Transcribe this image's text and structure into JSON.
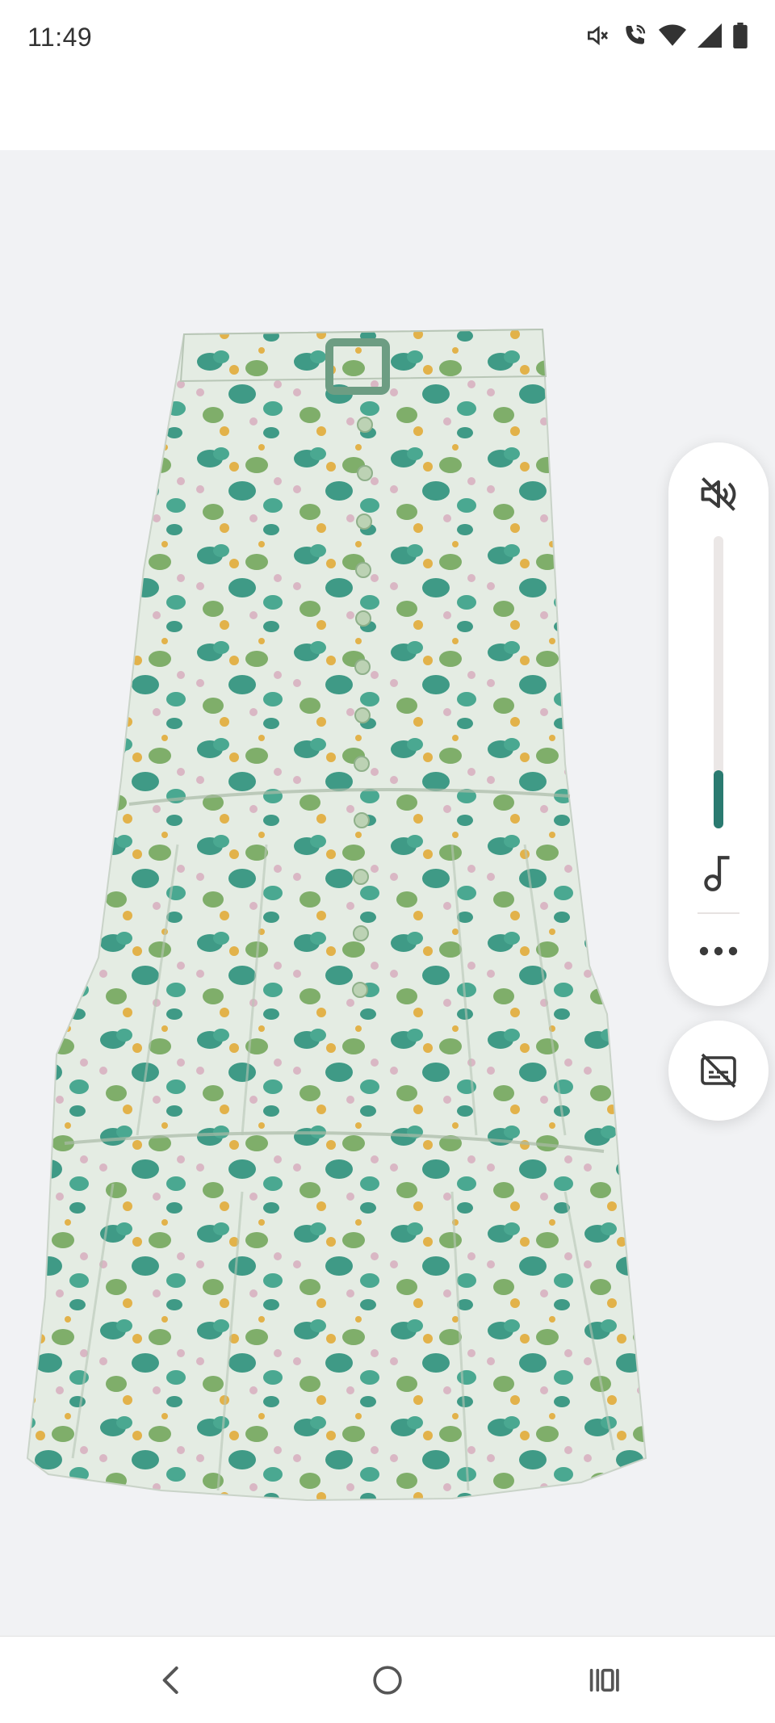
{
  "status_bar": {
    "time": "11:49",
    "icons": [
      "mute-icon",
      "wifi-call-icon",
      "wifi-icon",
      "cellular-signal-icon",
      "battery-icon"
    ]
  },
  "product_image": {
    "subject": "floral-print-midi-skirt",
    "colors": {
      "background": "#f1f2f4",
      "fabric": "#e4ece3",
      "leaf_teal": "#3f9a86",
      "leaf_green": "#7fae6a",
      "flower_yellow": "#e2b24a",
      "flower_pink": "#d9b7c4"
    }
  },
  "volume_panel": {
    "level_percent": 20,
    "accent_color": "#2a7a70",
    "icons": [
      "volume-mute-icon",
      "music-note-icon",
      "more-options-icon"
    ]
  },
  "caption_button": {
    "icon": "captions-off-icon"
  },
  "nav_bar": {
    "icons": [
      "back-icon",
      "home-icon",
      "recents-icon"
    ]
  }
}
